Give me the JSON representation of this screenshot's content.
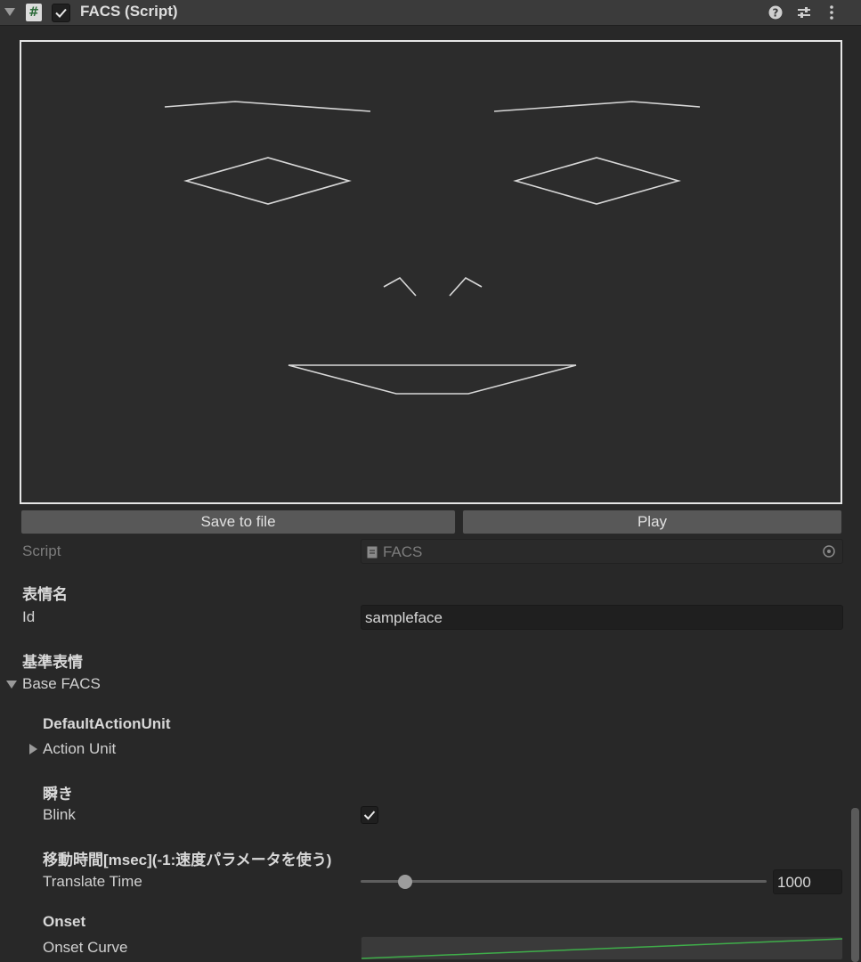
{
  "header": {
    "title": "FACS (Script)",
    "script_icon_glyph": "#",
    "icons": [
      "help-icon",
      "presets-icon",
      "more-menu-icon"
    ]
  },
  "preview": {
    "border_color": "#e6e6e6",
    "line_color": "#d8d8d8"
  },
  "buttons": {
    "save_label": "Save to file",
    "play_label": "Play"
  },
  "script_field": {
    "label": "Script",
    "value": "FACS"
  },
  "id_section": {
    "header": "表情名",
    "label": "Id",
    "value": "sampleface"
  },
  "base_section": {
    "header": "基準表情",
    "foldout_label": "Base FACS"
  },
  "default_action_unit": {
    "header": "DefaultActionUnit",
    "foldout_label": "Action Unit"
  },
  "blink": {
    "header": "瞬き",
    "label": "Blink",
    "checked": true
  },
  "translate": {
    "header": "移動時間[msec](-1:速度パラメータを使う)",
    "label": "Translate Time",
    "value": "1000",
    "slider_fraction": 0.11
  },
  "onset": {
    "header": "Onset",
    "label": "Onset Curve",
    "curve_color": "#3fae4a"
  },
  "colors": {
    "background": "#282828",
    "header_bg": "#3b3b3b",
    "button_bg": "#585858"
  }
}
